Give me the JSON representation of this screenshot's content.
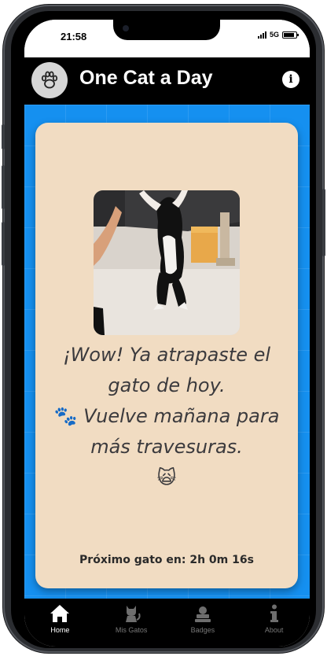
{
  "status_bar": {
    "time": "21:58",
    "network": "5G"
  },
  "header": {
    "title": "One Cat a Day",
    "logo_icon": "paw-icon",
    "info_icon": "info-icon"
  },
  "card": {
    "message_line1": "¡Wow! Ya atrapaste el gato de hoy.",
    "message_line2": "Vuelve mañana para más travesuras.",
    "emoji_paws": "🐾",
    "emoji_cat": "🙀",
    "countdown": "Próximo gato en: 2h 0m 16s"
  },
  "nav": {
    "items": [
      {
        "label": "Home",
        "icon": "home-icon",
        "active": true
      },
      {
        "label": "Mis Gatos",
        "icon": "cat-icon",
        "active": false
      },
      {
        "label": "Badges",
        "icon": "badge-icon",
        "active": false
      },
      {
        "label": "About",
        "icon": "info-icon",
        "active": false
      }
    ]
  },
  "colors": {
    "background_blue": "#1590f0",
    "card_beige": "#f1dcc2",
    "header_black": "#000000"
  }
}
